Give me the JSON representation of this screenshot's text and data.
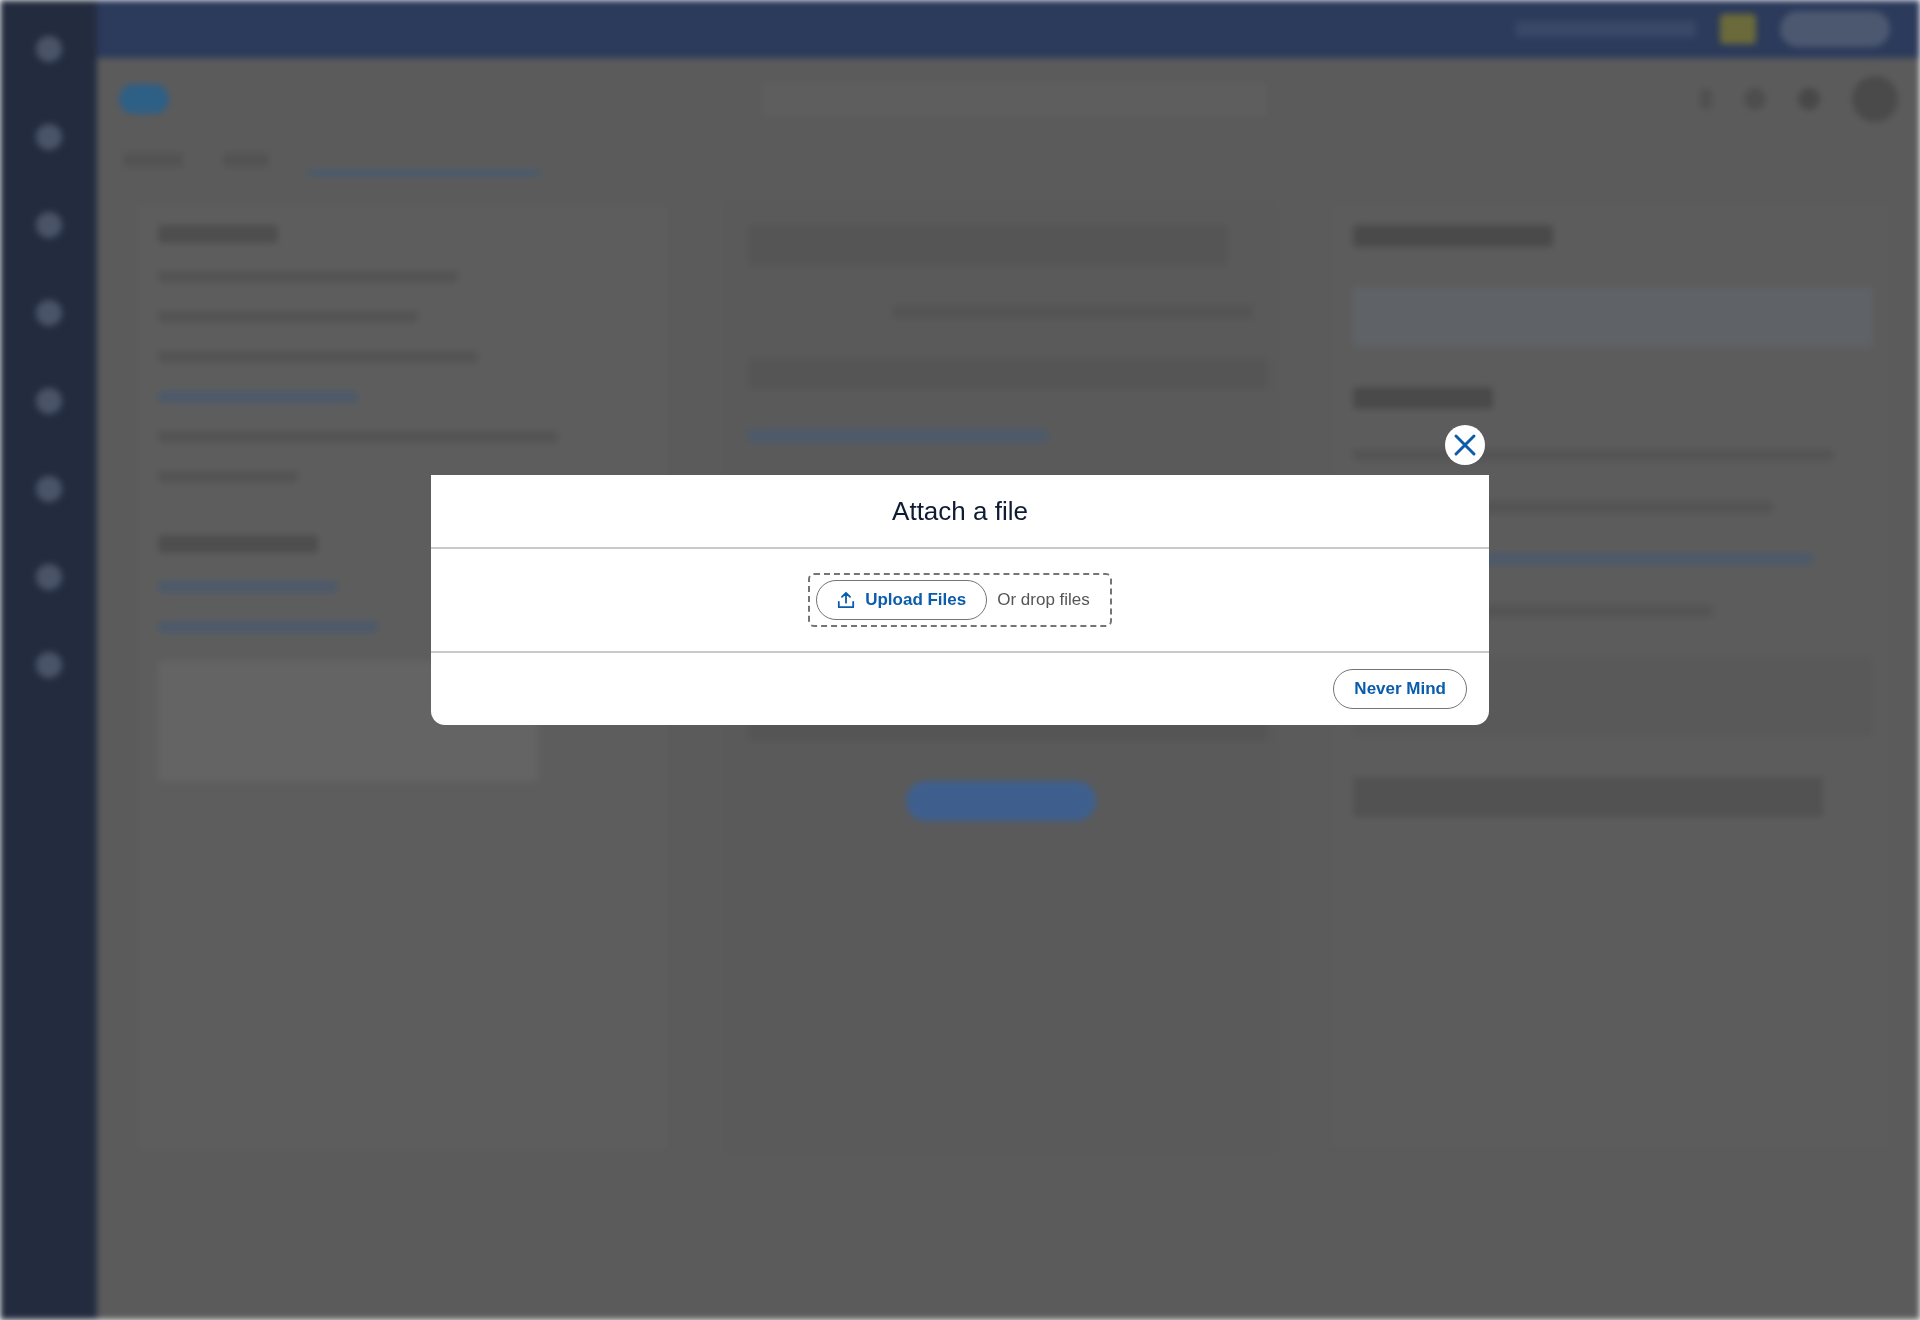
{
  "dialog": {
    "title": "Attach a file",
    "upload_button": "Upload Files",
    "drop_hint": "Or drop files",
    "cancel_button": "Never Mind"
  }
}
